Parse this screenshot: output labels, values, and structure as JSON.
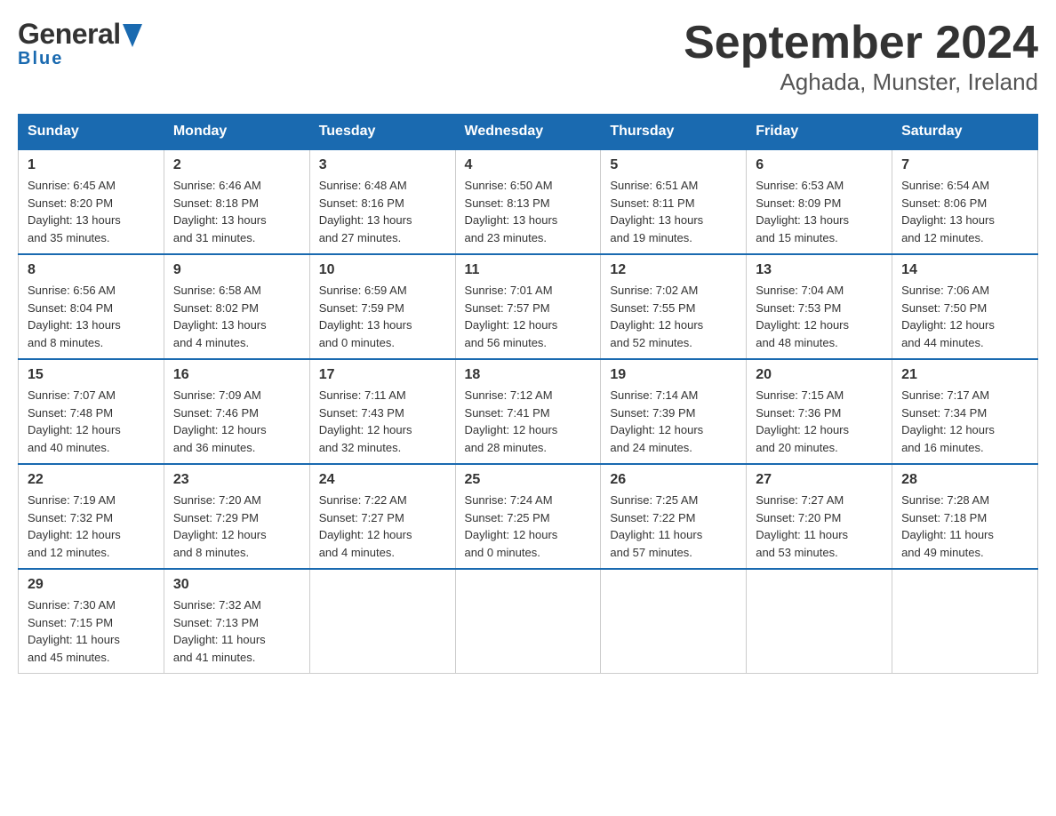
{
  "header": {
    "logo_general": "General",
    "logo_blue": "Blue",
    "title": "September 2024",
    "subtitle": "Aghada, Munster, Ireland"
  },
  "calendar": {
    "columns": [
      "Sunday",
      "Monday",
      "Tuesday",
      "Wednesday",
      "Thursday",
      "Friday",
      "Saturday"
    ],
    "weeks": [
      [
        {
          "day": "1",
          "info": "Sunrise: 6:45 AM\nSunset: 8:20 PM\nDaylight: 13 hours\nand 35 minutes."
        },
        {
          "day": "2",
          "info": "Sunrise: 6:46 AM\nSunset: 8:18 PM\nDaylight: 13 hours\nand 31 minutes."
        },
        {
          "day": "3",
          "info": "Sunrise: 6:48 AM\nSunset: 8:16 PM\nDaylight: 13 hours\nand 27 minutes."
        },
        {
          "day": "4",
          "info": "Sunrise: 6:50 AM\nSunset: 8:13 PM\nDaylight: 13 hours\nand 23 minutes."
        },
        {
          "day": "5",
          "info": "Sunrise: 6:51 AM\nSunset: 8:11 PM\nDaylight: 13 hours\nand 19 minutes."
        },
        {
          "day": "6",
          "info": "Sunrise: 6:53 AM\nSunset: 8:09 PM\nDaylight: 13 hours\nand 15 minutes."
        },
        {
          "day": "7",
          "info": "Sunrise: 6:54 AM\nSunset: 8:06 PM\nDaylight: 13 hours\nand 12 minutes."
        }
      ],
      [
        {
          "day": "8",
          "info": "Sunrise: 6:56 AM\nSunset: 8:04 PM\nDaylight: 13 hours\nand 8 minutes."
        },
        {
          "day": "9",
          "info": "Sunrise: 6:58 AM\nSunset: 8:02 PM\nDaylight: 13 hours\nand 4 minutes."
        },
        {
          "day": "10",
          "info": "Sunrise: 6:59 AM\nSunset: 7:59 PM\nDaylight: 13 hours\nand 0 minutes."
        },
        {
          "day": "11",
          "info": "Sunrise: 7:01 AM\nSunset: 7:57 PM\nDaylight: 12 hours\nand 56 minutes."
        },
        {
          "day": "12",
          "info": "Sunrise: 7:02 AM\nSunset: 7:55 PM\nDaylight: 12 hours\nand 52 minutes."
        },
        {
          "day": "13",
          "info": "Sunrise: 7:04 AM\nSunset: 7:53 PM\nDaylight: 12 hours\nand 48 minutes."
        },
        {
          "day": "14",
          "info": "Sunrise: 7:06 AM\nSunset: 7:50 PM\nDaylight: 12 hours\nand 44 minutes."
        }
      ],
      [
        {
          "day": "15",
          "info": "Sunrise: 7:07 AM\nSunset: 7:48 PM\nDaylight: 12 hours\nand 40 minutes."
        },
        {
          "day": "16",
          "info": "Sunrise: 7:09 AM\nSunset: 7:46 PM\nDaylight: 12 hours\nand 36 minutes."
        },
        {
          "day": "17",
          "info": "Sunrise: 7:11 AM\nSunset: 7:43 PM\nDaylight: 12 hours\nand 32 minutes."
        },
        {
          "day": "18",
          "info": "Sunrise: 7:12 AM\nSunset: 7:41 PM\nDaylight: 12 hours\nand 28 minutes."
        },
        {
          "day": "19",
          "info": "Sunrise: 7:14 AM\nSunset: 7:39 PM\nDaylight: 12 hours\nand 24 minutes."
        },
        {
          "day": "20",
          "info": "Sunrise: 7:15 AM\nSunset: 7:36 PM\nDaylight: 12 hours\nand 20 minutes."
        },
        {
          "day": "21",
          "info": "Sunrise: 7:17 AM\nSunset: 7:34 PM\nDaylight: 12 hours\nand 16 minutes."
        }
      ],
      [
        {
          "day": "22",
          "info": "Sunrise: 7:19 AM\nSunset: 7:32 PM\nDaylight: 12 hours\nand 12 minutes."
        },
        {
          "day": "23",
          "info": "Sunrise: 7:20 AM\nSunset: 7:29 PM\nDaylight: 12 hours\nand 8 minutes."
        },
        {
          "day": "24",
          "info": "Sunrise: 7:22 AM\nSunset: 7:27 PM\nDaylight: 12 hours\nand 4 minutes."
        },
        {
          "day": "25",
          "info": "Sunrise: 7:24 AM\nSunset: 7:25 PM\nDaylight: 12 hours\nand 0 minutes."
        },
        {
          "day": "26",
          "info": "Sunrise: 7:25 AM\nSunset: 7:22 PM\nDaylight: 11 hours\nand 57 minutes."
        },
        {
          "day": "27",
          "info": "Sunrise: 7:27 AM\nSunset: 7:20 PM\nDaylight: 11 hours\nand 53 minutes."
        },
        {
          "day": "28",
          "info": "Sunrise: 7:28 AM\nSunset: 7:18 PM\nDaylight: 11 hours\nand 49 minutes."
        }
      ],
      [
        {
          "day": "29",
          "info": "Sunrise: 7:30 AM\nSunset: 7:15 PM\nDaylight: 11 hours\nand 45 minutes."
        },
        {
          "day": "30",
          "info": "Sunrise: 7:32 AM\nSunset: 7:13 PM\nDaylight: 11 hours\nand 41 minutes."
        },
        {
          "day": "",
          "info": ""
        },
        {
          "day": "",
          "info": ""
        },
        {
          "day": "",
          "info": ""
        },
        {
          "day": "",
          "info": ""
        },
        {
          "day": "",
          "info": ""
        }
      ]
    ]
  }
}
